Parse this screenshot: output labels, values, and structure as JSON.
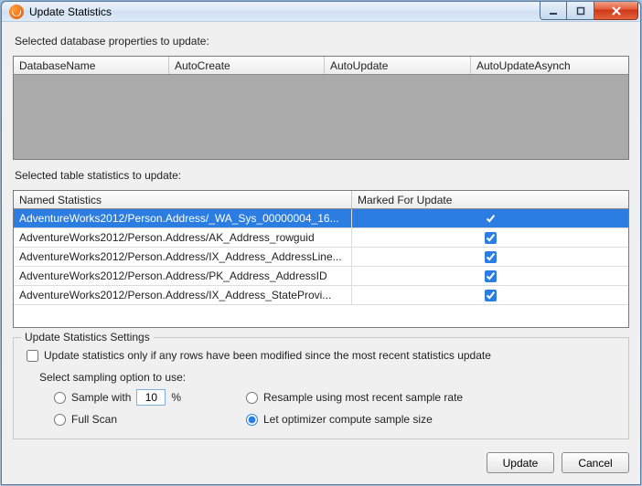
{
  "window": {
    "title": "Update Statistics"
  },
  "section1": {
    "label": "Selected database properties to update:",
    "columns": [
      "DatabaseName",
      "AutoCreate",
      "AutoUpdate",
      "AutoUpdateAsynch"
    ]
  },
  "section2": {
    "label": "Selected table statistics to update:",
    "columns": [
      "Named Statistics",
      "Marked For Update"
    ],
    "rows": [
      {
        "name": "AdventureWorks2012/Person.Address/_WA_Sys_00000004_16...",
        "checked": true,
        "selected": true
      },
      {
        "name": "AdventureWorks2012/Person.Address/AK_Address_rowguid",
        "checked": true,
        "selected": false
      },
      {
        "name": "AdventureWorks2012/Person.Address/IX_Address_AddressLine...",
        "checked": true,
        "selected": false
      },
      {
        "name": "AdventureWorks2012/Person.Address/PK_Address_AddressID",
        "checked": true,
        "selected": false
      },
      {
        "name": "AdventureWorks2012/Person.Address/IX_Address_StateProvi...",
        "checked": true,
        "selected": false
      }
    ]
  },
  "settings": {
    "legend": "Update Statistics Settings",
    "only_modified_label": "Update statistics only if any rows have been modified since the most recent statistics update",
    "only_modified_checked": false,
    "sampling_label": "Select sampling option to use:",
    "sample_with_label": "Sample with",
    "sample_value": "10",
    "sample_pct": "%",
    "full_scan_label": "Full Scan",
    "resample_label": "Resample using most recent sample rate",
    "optimizer_label": "Let optimizer compute sample size",
    "selected_option": "optimizer"
  },
  "footer": {
    "update": "Update",
    "cancel": "Cancel"
  }
}
